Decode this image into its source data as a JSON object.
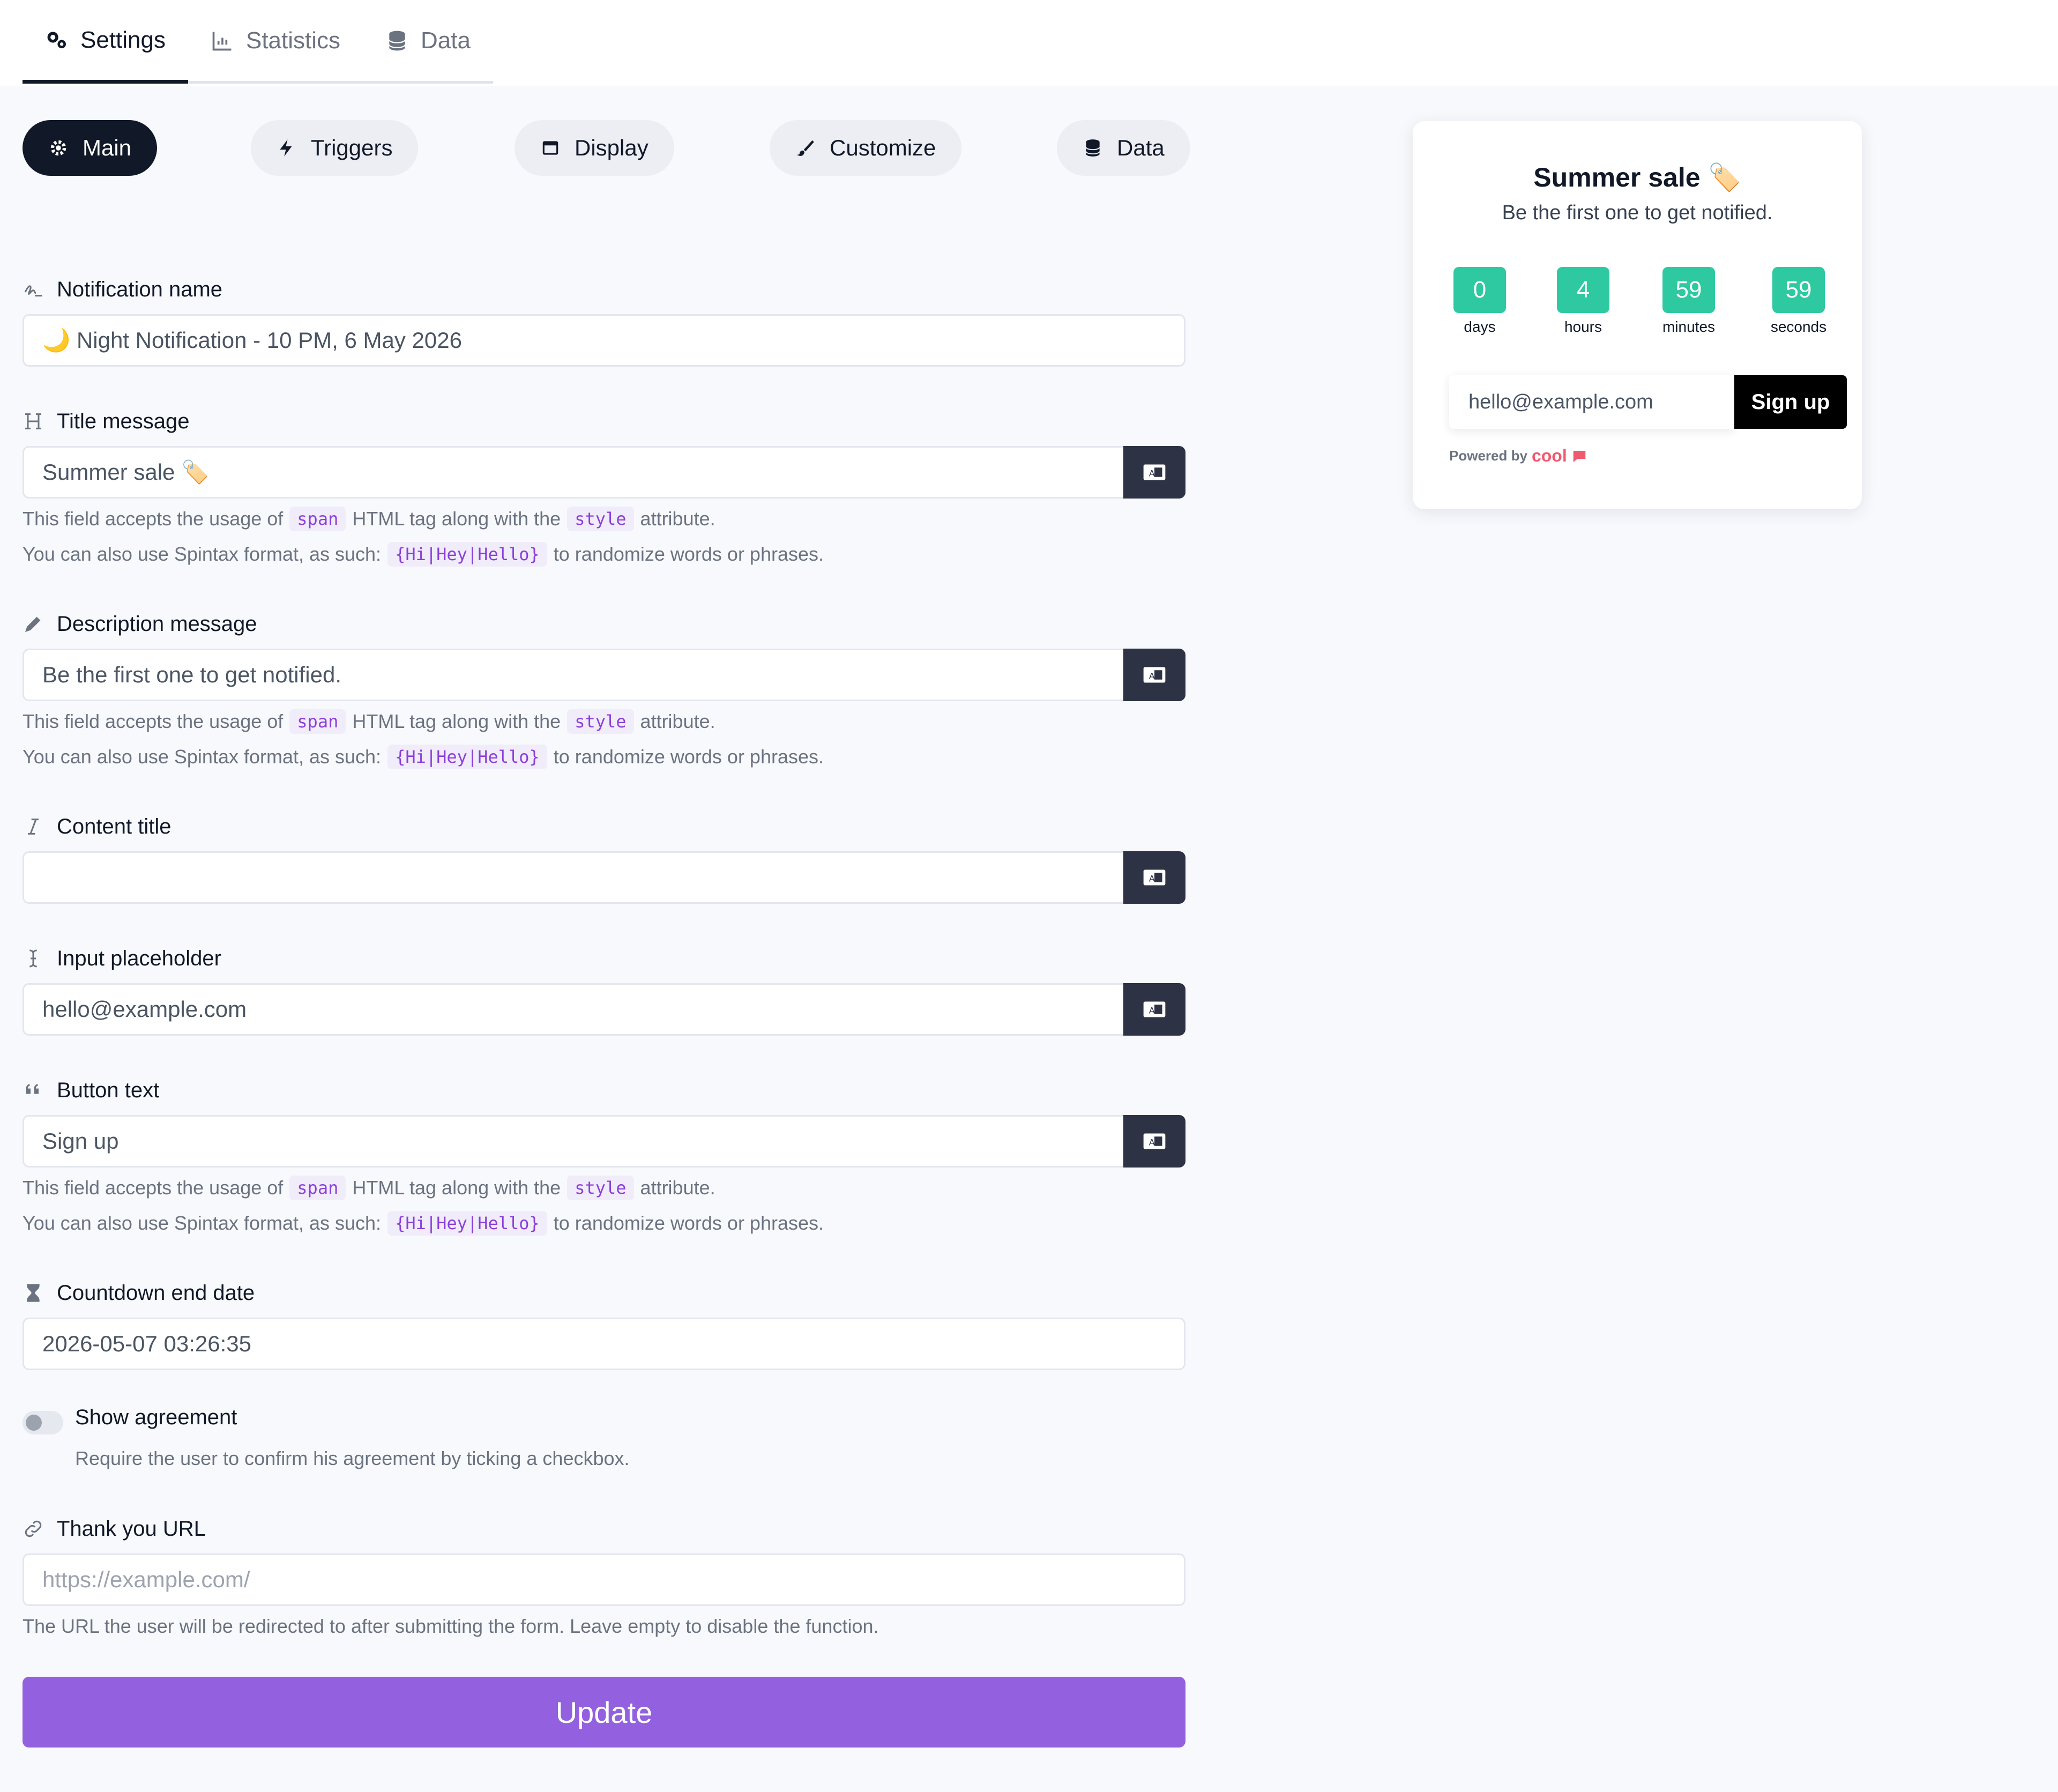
{
  "tabs": [
    {
      "label": "Settings",
      "icon": "gears-icon"
    },
    {
      "label": "Statistics",
      "icon": "chart-icon"
    },
    {
      "label": "Data",
      "icon": "database-icon"
    }
  ],
  "pills": [
    {
      "label": "Main",
      "icon": "gear-icon"
    },
    {
      "label": "Triggers",
      "icon": "bolt-icon"
    },
    {
      "label": "Display",
      "icon": "window-icon"
    },
    {
      "label": "Customize",
      "icon": "paintbrush-icon"
    },
    {
      "label": "Data",
      "icon": "database-icon"
    }
  ],
  "fields": {
    "notification_name": {
      "label": "Notification name",
      "value": "🌙 Night Notification - 10 PM, 6 May 2026"
    },
    "title_message": {
      "label": "Title message",
      "value": "Summer sale 🏷️"
    },
    "description_message": {
      "label": "Description message",
      "value": "Be the first one to get notified."
    },
    "content_title": {
      "label": "Content title",
      "value": ""
    },
    "input_placeholder": {
      "label": "Input placeholder",
      "value": "hello@example.com"
    },
    "button_text": {
      "label": "Button text",
      "value": "Sign up"
    },
    "countdown_end_date": {
      "label": "Countdown end date",
      "value": "2026-05-07 03:26:35"
    },
    "thank_you_url": {
      "label": "Thank you URL",
      "placeholder": "https://example.com/",
      "help": "The URL the user will be redirected to after submitting the form. Leave empty to disable the function."
    }
  },
  "help": {
    "line1_a": "This field accepts the usage of",
    "line1_code1": "span",
    "line1_b": "HTML tag along with the",
    "line1_code2": "style",
    "line1_c": "attribute.",
    "line2_a": "You can also use Spintax format, as such:",
    "line2_code": "{Hi|Hey|Hello}",
    "line2_b": "to randomize words or phrases."
  },
  "agreement": {
    "label": "Show agreement",
    "help": "Require the user to confirm his agreement by ticking a checkbox.",
    "enabled": false
  },
  "update_label": "Update",
  "preview": {
    "title": "Summer sale 🏷️",
    "description": "Be the first one to get notified.",
    "countdown": [
      {
        "value": "0",
        "label": "days"
      },
      {
        "value": "4",
        "label": "hours"
      },
      {
        "value": "59",
        "label": "minutes"
      },
      {
        "value": "59",
        "label": "seconds"
      }
    ],
    "input_placeholder": "hello@example.com",
    "button": "Sign up",
    "powered_by": "Powered by",
    "brand": "cool"
  },
  "colors": {
    "accent": "#9360e0",
    "countdown": "#2ec9a0",
    "dark": "#111827",
    "brand": "#f05a70"
  }
}
